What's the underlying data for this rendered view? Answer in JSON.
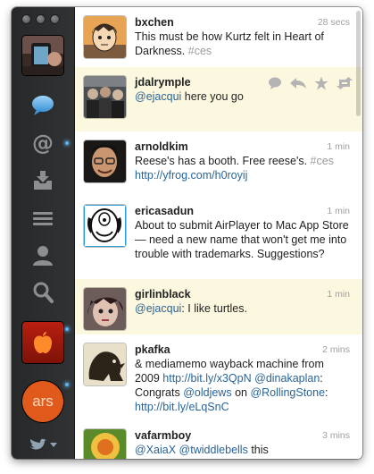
{
  "window": {
    "sidebar": {
      "nav_icons": [
        "speech-bubble-icon",
        "at-mention-icon",
        "inbox-tray-icon",
        "list-icon",
        "person-icon",
        "search-icon"
      ],
      "ars_label": "ars"
    },
    "tweets": [
      {
        "user": "bxchen",
        "time": "28 secs",
        "text_plain": "This must be how Kurtz felt in Heart of Darkness. ",
        "hashtag": "#ces"
      },
      {
        "user": "jdalrymple",
        "time": "",
        "mention": "@ejacqui",
        "text_after": " here you go"
      },
      {
        "user": "arnoldkim",
        "time": "1 min",
        "text_plain": "Reese's has a booth. Free reese's. ",
        "hashtag": "#ces",
        "link": "http://yfrog.com/h0royij"
      },
      {
        "user": "ericasadun",
        "time": "1 min",
        "text_plain": "About to submit AirPlayer to Mac App Store — need a new name that won't get me into trouble with trademarks. Suggestions?"
      },
      {
        "user": "girlinblack",
        "time": "1 min",
        "mention": "@ejacqui",
        "text_after": ": I like turtles."
      },
      {
        "user": "pkafka",
        "time": "2 mins",
        "text_1": "& mediamemo wayback machine from 2009 ",
        "link_1": "http://bit.ly/x3QpN",
        "mention_1": "@dinakaplan",
        "text_2": ": Congrats ",
        "mention_2": "@oldjews",
        "text_3": " on ",
        "mention_3": "@RollingStone",
        "text_4": ": ",
        "link_2": "http://bit.ly/eLqSnC"
      },
      {
        "user": "vafarmboy",
        "time": "3 mins",
        "mention_1": "@XaiaX",
        "mention_2": "@twiddlebells",
        "text_after": " this"
      }
    ]
  },
  "colors": {
    "sidebar": "#2a2c2e",
    "mention_highlight": "#fcf8df",
    "link": "#2a6496",
    "hashtag": "#9a9a9a",
    "nav_active": "#5fb0e8"
  }
}
